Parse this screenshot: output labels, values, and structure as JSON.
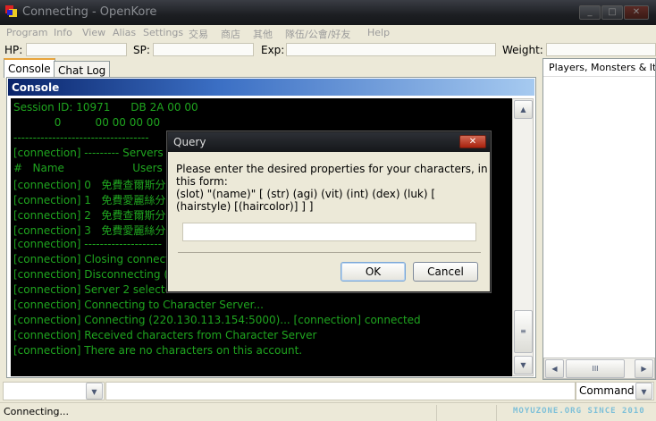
{
  "window": {
    "title": "Connecting - OpenKore",
    "buttons": [
      "minimize",
      "maximize",
      "close"
    ]
  },
  "menu": [
    "Program",
    "Info",
    "View",
    "Alias",
    "Settings",
    "交易",
    "商店",
    "其他",
    "隊伍/公會/好友",
    "Help"
  ],
  "stats": {
    "hp_label": "HP:",
    "sp_label": "SP:",
    "exp_label": "Exp:",
    "weight_label": "Weight:"
  },
  "tabs": [
    {
      "label": "Console",
      "active": true
    },
    {
      "label": "Chat Log",
      "active": false
    }
  ],
  "console": {
    "header": "Console",
    "text_color": "#1fa51f",
    "lines": [
      "Session ID: 10971      DB 2A 00 00",
      "            0          00 00 00 00",
      "-----------------------------------",
      "[connection] --------- Servers ---",
      "#   Name                    Users  IP",
      "[connection] 0   免費查爾斯分流",
      "[connection] 1   免費愛麗絲分流",
      "[connection] 2   免費查爾斯分流",
      "[connection] 3   免費愛麗絲分流",
      "[connection] --------------------",
      "[connection] Closing connection",
      "[connection] Disconnecting (22",
      "[connection] Server 2 selected",
      "[connection] Connecting to Character Server...",
      "[connection] Connecting (220.130.113.154:5000)... [connection] connected",
      "[connection] Received characters from Character Server",
      "[connection] There are no characters on this account."
    ]
  },
  "right_panel": {
    "header": "Players, Monsters & Iter"
  },
  "input_bar": {
    "command_value": "Command"
  },
  "status": {
    "text": "Connecting...",
    "watermark": "MOYUZONE.ORG SINCE 2010"
  },
  "dialog": {
    "title": "Query",
    "message": "Please enter the desired properties for your characters, in this form:\n(slot) \"(name)\" [ (str) (agi) (vit) (int) (dex) (luk) [ (hairstyle) [(haircolor)] ] ]",
    "input_value": "",
    "ok": "OK",
    "cancel": "Cancel"
  }
}
